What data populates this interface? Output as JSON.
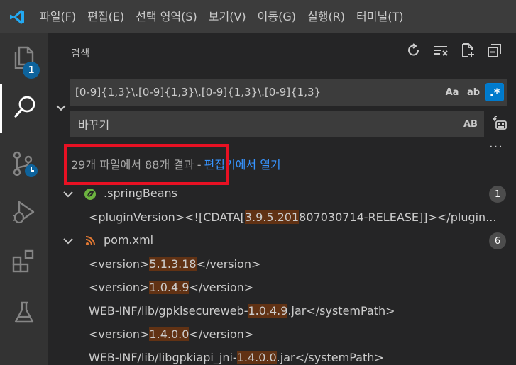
{
  "menubar": {
    "items": [
      "파일(F)",
      "편집(E)",
      "선택 영역(S)",
      "보기(V)",
      "이동(G)",
      "실행(R)",
      "터미널(T)"
    ]
  },
  "activity": {
    "explorer_badge": "1"
  },
  "panel": {
    "title": "검색"
  },
  "search": {
    "query": "[0-9]{1,3}\\.[0-9]{1,3}\\.[0-9]{1,3}\\.[0-9]{1,3}",
    "match_case_label": "Aa",
    "whole_word_label": "ab",
    "regex_label": ".*",
    "regex_enabled": true
  },
  "replace": {
    "placeholder": "바꾸기",
    "preserve_case_label": "AB"
  },
  "results": {
    "summary": "29개 파일에서 88개 결과",
    "dash": "-",
    "open_in_editor": "편집기에서 열기",
    "files": [
      {
        "name": ".springBeans",
        "icon": "spring-leaf-icon",
        "count": "1",
        "matches": [
          {
            "before": "<pluginVersion><![CDATA[",
            "hl": "3.9.5.201",
            "after": "807030714-RELEASE]]></plugin..."
          }
        ]
      },
      {
        "name": "pom.xml",
        "icon": "rss-icon",
        "count": "6",
        "matches": [
          {
            "before": "<version>",
            "hl": "5.1.3.18",
            "after": "</version>"
          },
          {
            "before": "<version>",
            "hl": "1.0.4.9",
            "after": "</version>"
          },
          {
            "before": "WEB-INF/lib/gpkisecureweb-",
            "hl": "1.0.4.9",
            "after": ".jar</systemPath>"
          },
          {
            "before": "<version>",
            "hl": "1.4.0.0",
            "after": "</version>"
          },
          {
            "before": "WEB-INF/lib/libgpkiapi_jni-",
            "hl": "1.4.0.0",
            "after": ".jar</systemPath>"
          }
        ]
      }
    ]
  },
  "colors": {
    "accent": "#007acc",
    "link": "#3794ff",
    "highlight": "#613214",
    "annotation_box": "#e81123"
  }
}
